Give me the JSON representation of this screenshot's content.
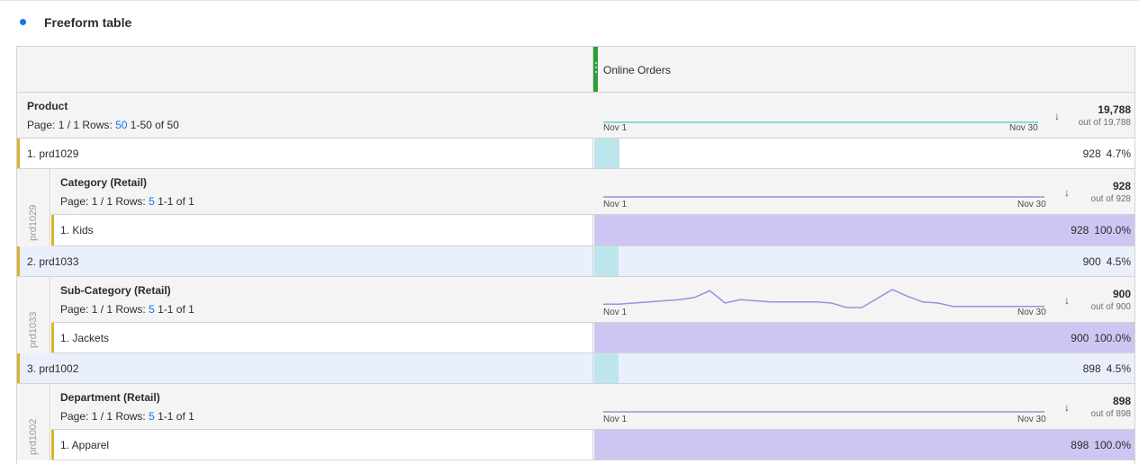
{
  "panel": {
    "title": "Freeform table",
    "accent": "#1473e6"
  },
  "metric": {
    "label": "Online Orders",
    "color": "#2d9d3a"
  },
  "product": {
    "name": "Product",
    "page": "Page: 1 / 1",
    "rows_label": "Rows:",
    "rows": "50",
    "range": "1-50 of 50",
    "date_start": "Nov 1",
    "date_end": "Nov 30",
    "sort_icon": "arrow-down-icon",
    "total": "19,788",
    "out_of": "out of 19,788",
    "spark_values": [
      1,
      1,
      1,
      1,
      1,
      1,
      1,
      1,
      1,
      1,
      1,
      1,
      1,
      1,
      1,
      1,
      1,
      1,
      1,
      1,
      1,
      1,
      1,
      1,
      1,
      1,
      1,
      1,
      1,
      1
    ]
  },
  "items": [
    {
      "label": "1.  prd1029",
      "value": "928",
      "percent": "4.7%",
      "share": 0.047,
      "side": "prd1029",
      "breakdown": {
        "name": "Category (Retail)",
        "page": "Page: 1 / 1",
        "rows_label": "Rows:",
        "rows": "5",
        "range": "1-1 of 1",
        "date_start": "Nov 1",
        "date_end": "Nov 30",
        "total": "928",
        "out_of": "out of 928",
        "spark_values": [
          1,
          1,
          1,
          1,
          1,
          1,
          1,
          1,
          1,
          1,
          1,
          1,
          1,
          1,
          1,
          1,
          1,
          1,
          1,
          1,
          1,
          1,
          1,
          1,
          1,
          1,
          1,
          1,
          1,
          1
        ],
        "item": {
          "label": "1.  Kids",
          "value": "928",
          "percent": "100.0%",
          "share": 1.0
        }
      }
    },
    {
      "label": "2.  prd1033",
      "value": "900",
      "percent": "4.5%",
      "share": 0.045,
      "side": "prd1033",
      "breakdown": {
        "name": "Sub-Category (Retail)",
        "page": "Page: 1 / 1",
        "rows_label": "Rows:",
        "rows": "5",
        "range": "1-1 of 1",
        "date_start": "Nov 1",
        "date_end": "Nov 30",
        "total": "900",
        "out_of": "out of 900",
        "spark_values": [
          28,
          28,
          29,
          30,
          31,
          32,
          34,
          40,
          29,
          32,
          31,
          30,
          30,
          30,
          30,
          29,
          25,
          25,
          33,
          41,
          35,
          30,
          29,
          26,
          26,
          26,
          26,
          26,
          26,
          26
        ],
        "item": {
          "label": "1.  Jackets",
          "value": "900",
          "percent": "100.0%",
          "share": 1.0
        }
      }
    },
    {
      "label": "3.  prd1002",
      "value": "898",
      "percent": "4.5%",
      "share": 0.045,
      "side": "prd1002",
      "breakdown": {
        "name": "Department (Retail)",
        "page": "Page: 1 / 1",
        "rows_label": "Rows:",
        "rows": "5",
        "range": "1-1 of 1",
        "date_start": "Nov 1",
        "date_end": "Nov 30",
        "total": "898",
        "out_of": "out of 898",
        "spark_values": [
          1,
          1,
          1,
          1,
          1,
          1,
          1,
          1,
          1,
          1,
          1,
          1,
          1,
          1,
          1,
          1,
          1,
          1,
          1,
          1,
          1,
          1,
          1,
          1,
          1,
          1,
          1,
          1,
          1,
          1
        ],
        "item": {
          "label": "1.  Apparel",
          "value": "898",
          "percent": "100.0%",
          "share": 1.0
        }
      }
    }
  ],
  "colors": {
    "teal_bar": "#bde6ec",
    "teal_line": "#6ccbd2",
    "purple_bar": "#cdc6f2",
    "purple_line": "#9b8fe0",
    "marker": "#d9b42b",
    "link": "#1473e6"
  }
}
